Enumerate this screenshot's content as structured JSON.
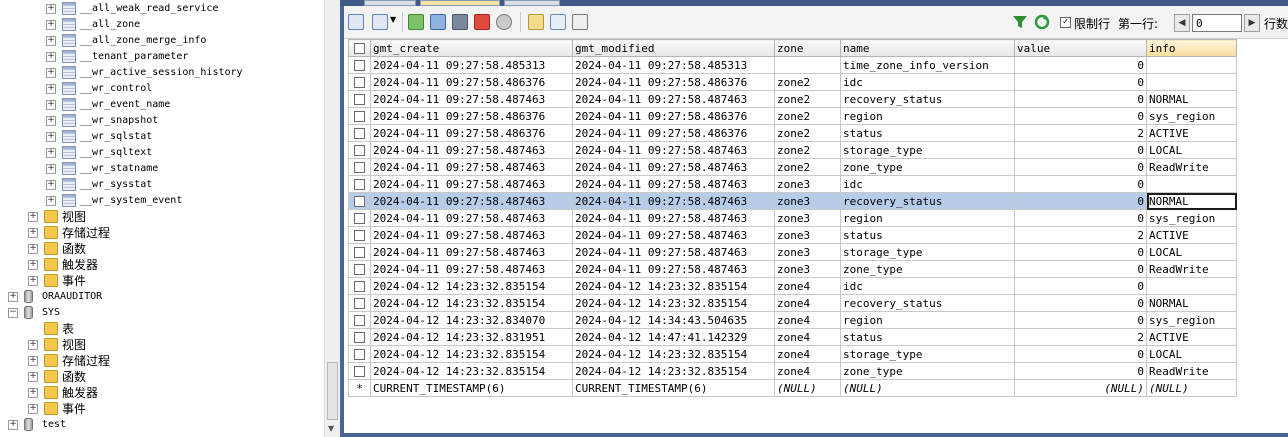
{
  "tree": {
    "tables": [
      "__all_weak_read_service",
      "__all_zone",
      "__all_zone_merge_info",
      "__tenant_parameter",
      "__wr_active_session_history",
      "__wr_control",
      "__wr_event_name",
      "__wr_snapshot",
      "__wr_sqlstat",
      "__wr_sqltext",
      "__wr_statname",
      "__wr_sysstat",
      "__wr_system_event"
    ],
    "folders_a": [
      "视图",
      "存储过程",
      "函数",
      "触发器",
      "事件"
    ],
    "db_oraauditor": "ORAAUDITOR",
    "db_sys": "SYS",
    "folders_sys": [
      "表",
      "视图",
      "存储过程",
      "函数",
      "触发器",
      "事件"
    ],
    "db_test": "test"
  },
  "toolbar": {
    "limit_rows_label": "限制行",
    "first_row_label": "第一行:",
    "offset_value": "0",
    "rows_label": "行数"
  },
  "grid": {
    "columns": [
      "gmt_create",
      "gmt_modified",
      "zone",
      "name",
      "value",
      "info"
    ],
    "rows": [
      [
        "2024-04-11 09:27:58.485313",
        "2024-04-11 09:27:58.485313",
        "",
        "time_zone_info_version",
        "0",
        ""
      ],
      [
        "2024-04-11 09:27:58.486376",
        "2024-04-11 09:27:58.486376",
        "zone2",
        "idc",
        "0",
        ""
      ],
      [
        "2024-04-11 09:27:58.487463",
        "2024-04-11 09:27:58.487463",
        "zone2",
        "recovery_status",
        "0",
        "NORMAL"
      ],
      [
        "2024-04-11 09:27:58.486376",
        "2024-04-11 09:27:58.486376",
        "zone2",
        "region",
        "0",
        "sys_region"
      ],
      [
        "2024-04-11 09:27:58.486376",
        "2024-04-11 09:27:58.486376",
        "zone2",
        "status",
        "2",
        "ACTIVE"
      ],
      [
        "2024-04-11 09:27:58.487463",
        "2024-04-11 09:27:58.487463",
        "zone2",
        "storage_type",
        "0",
        "LOCAL"
      ],
      [
        "2024-04-11 09:27:58.487463",
        "2024-04-11 09:27:58.487463",
        "zone2",
        "zone_type",
        "0",
        "ReadWrite"
      ],
      [
        "2024-04-11 09:27:58.487463",
        "2024-04-11 09:27:58.487463",
        "zone3",
        "idc",
        "0",
        ""
      ],
      [
        "2024-04-11 09:27:58.487463",
        "2024-04-11 09:27:58.487463",
        "zone3",
        "recovery_status",
        "0",
        "NORMAL"
      ],
      [
        "2024-04-11 09:27:58.487463",
        "2024-04-11 09:27:58.487463",
        "zone3",
        "region",
        "0",
        "sys_region"
      ],
      [
        "2024-04-11 09:27:58.487463",
        "2024-04-11 09:27:58.487463",
        "zone3",
        "status",
        "2",
        "ACTIVE"
      ],
      [
        "2024-04-11 09:27:58.487463",
        "2024-04-11 09:27:58.487463",
        "zone3",
        "storage_type",
        "0",
        "LOCAL"
      ],
      [
        "2024-04-11 09:27:58.487463",
        "2024-04-11 09:27:58.487463",
        "zone3",
        "zone_type",
        "0",
        "ReadWrite"
      ],
      [
        "2024-04-12 14:23:32.835154",
        "2024-04-12 14:23:32.835154",
        "zone4",
        "idc",
        "0",
        ""
      ],
      [
        "2024-04-12 14:23:32.835154",
        "2024-04-12 14:23:32.835154",
        "zone4",
        "recovery_status",
        "0",
        "NORMAL"
      ],
      [
        "2024-04-12 14:23:32.834070",
        "2024-04-12 14:34:43.504635",
        "zone4",
        "region",
        "0",
        "sys_region"
      ],
      [
        "2024-04-12 14:23:32.831951",
        "2024-04-12 14:47:41.142329",
        "zone4",
        "status",
        "2",
        "ACTIVE"
      ],
      [
        "2024-04-12 14:23:32.835154",
        "2024-04-12 14:23:32.835154",
        "zone4",
        "storage_type",
        "0",
        "LOCAL"
      ],
      [
        "2024-04-12 14:23:32.835154",
        "2024-04-12 14:23:32.835154",
        "zone4",
        "zone_type",
        "0",
        "ReadWrite"
      ]
    ],
    "selected_row_index": 8,
    "new_row": {
      "marker": "*",
      "values": [
        "CURRENT_TIMESTAMP(6)",
        "CURRENT_TIMESTAMP(6)",
        "(NULL)",
        "(NULL)",
        "(NULL)",
        "(NULL)"
      ]
    }
  },
  "colors": {
    "panel_bg": "#4a6591",
    "selected_row": "#b7cce8",
    "info_header": "#f6dc9a"
  }
}
